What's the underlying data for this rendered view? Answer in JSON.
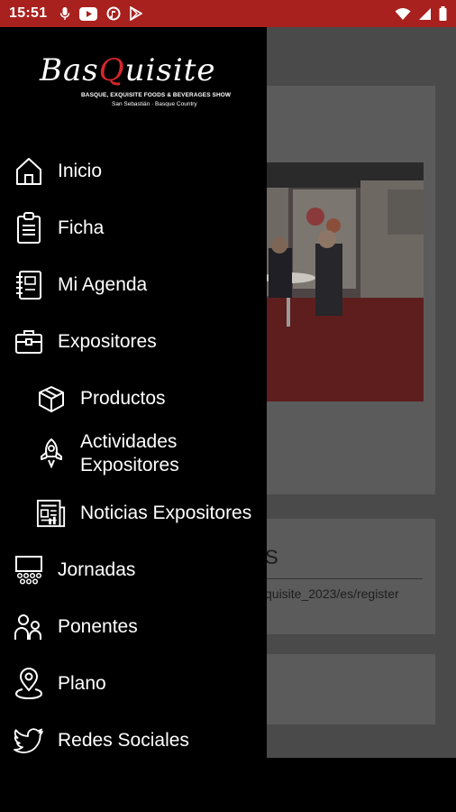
{
  "status_bar": {
    "time": "15:51",
    "notification_icons": [
      "mic-icon",
      "youtube-icon",
      "no-music-icon",
      "play-store-icon"
    ],
    "system_icons": [
      "wifi-icon",
      "signal-icon",
      "battery-icon"
    ]
  },
  "drawer": {
    "logo": {
      "brand_prefix": "Bas",
      "brand_highlight": "Q",
      "brand_suffix": "uisite",
      "tagline_1": "BASQUE, EXQUISITE FOODS & BEVERAGES SHOW",
      "tagline_2": "San Sebastián · Basque Country"
    },
    "items": [
      {
        "label": "Inicio",
        "icon": "home-icon"
      },
      {
        "label": "Ficha",
        "icon": "clipboard-icon"
      },
      {
        "label": "Mi Agenda",
        "icon": "agenda-icon"
      },
      {
        "label": "Expositores",
        "icon": "briefcase-icon"
      },
      {
        "label": "Productos",
        "icon": "box-icon"
      },
      {
        "label": "Actividades Expositores",
        "label_line1": "Actividades",
        "label_line2": "Expositores",
        "icon": "rocket-icon"
      },
      {
        "label": "Noticias Expositores",
        "icon": "news-icon"
      },
      {
        "label": "Jornadas",
        "icon": "audience-icon"
      },
      {
        "label": "Ponentes",
        "icon": "people-icon"
      },
      {
        "label": "Plano",
        "icon": "map-pin-icon"
      },
      {
        "label": "Redes Sociales",
        "icon": "twitter-icon"
      }
    ]
  },
  "background": {
    "card2_heading": "S",
    "card2_link": "quisite_2023/es/register"
  },
  "colors": {
    "status_bar": "#a8211e",
    "drawer_bg": "#000000",
    "scrim": "#4a4a4a",
    "brand_red": "#d7262a"
  }
}
